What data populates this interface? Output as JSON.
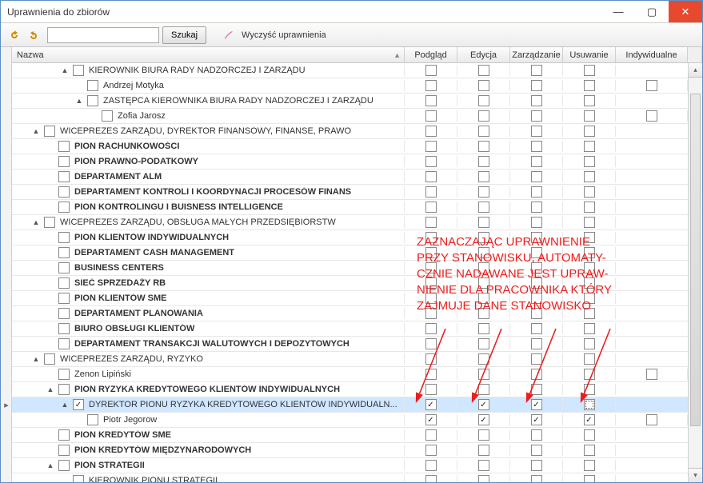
{
  "window": {
    "title": "Uprawnienia do zbiorów"
  },
  "toolbar": {
    "search_button": "Szukaj",
    "clear_button": "Wyczyść uprawnienia",
    "search_placeholder": ""
  },
  "columns": {
    "name": "Nazwa",
    "preview": "Podgląd",
    "edit": "Edycja",
    "manage": "Zarządzanie",
    "delete": "Usuwanie",
    "individual": "Indywidualne"
  },
  "rows": [
    {
      "level": 3,
      "exp": "▲",
      "cb": false,
      "text": "KIEROWNIK BIURA RADY NADZORCZEJ I ZARZĄDU",
      "bold": false,
      "ind": false
    },
    {
      "level": 4,
      "exp": "",
      "cb": false,
      "text": "Andrzej Motyka",
      "bold": false,
      "ind": true
    },
    {
      "level": 4,
      "exp": "▲",
      "cb": false,
      "text": "ZASTĘPCA KIEROWNIKA BIURA RADY NADZORCZEJ I ZARZĄDU",
      "bold": false,
      "ind": false
    },
    {
      "level": 5,
      "exp": "",
      "cb": false,
      "text": "Zofia Jarosz",
      "bold": false,
      "ind": true
    },
    {
      "level": 1,
      "exp": "▲",
      "cb": false,
      "text": "WICEPREZES ZARZĄDU, DYREKTOR FINANSOWY, FINANSE, PRAWO",
      "bold": false,
      "ind": false
    },
    {
      "level": 2,
      "exp": "",
      "cb": false,
      "text": "PION RACHUNKOWOŚCI",
      "bold": true,
      "ind": false
    },
    {
      "level": 2,
      "exp": "",
      "cb": false,
      "text": "PION PRAWNO-PODATKOWY",
      "bold": true,
      "ind": false
    },
    {
      "level": 2,
      "exp": "",
      "cb": false,
      "text": "DEPARTAMENT ALM",
      "bold": true,
      "ind": false
    },
    {
      "level": 2,
      "exp": "",
      "cb": false,
      "text": "DEPARTAMENT KONTROLI I KOORDYNACJI PROCESÓW FINANS",
      "bold": true,
      "ind": false
    },
    {
      "level": 2,
      "exp": "",
      "cb": false,
      "text": "PION KONTROLINGU I BUISNESS INTELLIGENCE",
      "bold": true,
      "ind": false
    },
    {
      "level": 1,
      "exp": "▲",
      "cb": false,
      "text": "WICEPREZES ZARZĄDU, OBSŁUGA MAŁYCH PRZEDSIĘBIORSTW",
      "bold": false,
      "ind": false
    },
    {
      "level": 2,
      "exp": "",
      "cb": false,
      "text": "PION KLIENTÓW INDYWIDUALNYCH",
      "bold": true,
      "ind": false
    },
    {
      "level": 2,
      "exp": "",
      "cb": false,
      "text": "DEPARTAMENT CASH MANAGEMENT",
      "bold": true,
      "ind": false
    },
    {
      "level": 2,
      "exp": "",
      "cb": false,
      "text": "BUSINESS CENTERS",
      "bold": true,
      "ind": false
    },
    {
      "level": 2,
      "exp": "",
      "cb": false,
      "text": "SIEĆ SPRZEDAŻY RB",
      "bold": true,
      "ind": false
    },
    {
      "level": 2,
      "exp": "",
      "cb": false,
      "text": "PION KLIENTÓW SME",
      "bold": true,
      "ind": false
    },
    {
      "level": 2,
      "exp": "",
      "cb": false,
      "text": "DEPARTAMENT PLANOWANIA",
      "bold": true,
      "ind": false
    },
    {
      "level": 2,
      "exp": "",
      "cb": false,
      "text": "BIURO OBSŁUGI KLIENTÓW",
      "bold": true,
      "ind": false
    },
    {
      "level": 2,
      "exp": "",
      "cb": false,
      "text": "DEPARTAMENT TRANSAKCJI WALUTOWYCH I DEPOZYTOWYCH",
      "bold": true,
      "ind": false
    },
    {
      "level": 1,
      "exp": "▲",
      "cb": false,
      "text": "WICEPREZES ZARZĄDU, RYZYKO",
      "bold": false,
      "ind": false
    },
    {
      "level": 2,
      "exp": "",
      "cb": false,
      "text": "Zenon Lipiński",
      "bold": false,
      "ind": true
    },
    {
      "level": 2,
      "exp": "▲",
      "cb": false,
      "text": "PION RYZYKA KREDYTOWEGO KLIENTÓW INDYWIDUALNYCH",
      "bold": true,
      "ind": false
    },
    {
      "level": 3,
      "exp": "▲",
      "cb": true,
      "text": "DYREKTOR PIONU RYZYKA KREDYTOWEGO KLIENTÓW INDYWIDUALN...",
      "bold": false,
      "ind": false,
      "selected": true,
      "perm": [
        true,
        true,
        true,
        "dotted"
      ]
    },
    {
      "level": 4,
      "exp": "",
      "cb": false,
      "text": "Piotr Jegorow",
      "bold": false,
      "ind": true,
      "perm": [
        true,
        true,
        true,
        true
      ]
    },
    {
      "level": 2,
      "exp": "",
      "cb": false,
      "text": "PION KREDYTÓW SME",
      "bold": true,
      "ind": false
    },
    {
      "level": 2,
      "exp": "",
      "cb": false,
      "text": "PION KREDYTÓW MIĘDZYNARODOWYCH",
      "bold": true,
      "ind": false
    },
    {
      "level": 2,
      "exp": "▲",
      "cb": false,
      "text": "PION STRATEGII",
      "bold": true,
      "ind": false
    },
    {
      "level": 3,
      "exp": "",
      "cb": false,
      "text": "KIEROWNIK PIONU STRATEGII",
      "bold": false,
      "ind": false
    }
  ],
  "annotation": {
    "lines": [
      "ZAZNACZAJĄC UPRAWNIENIE",
      "PRZY STANOWISKU, AUTOMATY-",
      "CZNIE NADAWANE JEST UPRAW-",
      "NIENIE DLA PRACOWNIKA KTÓRY",
      "ZAJMUJE DANE STANOWISKO"
    ]
  },
  "current_row_index": 22
}
